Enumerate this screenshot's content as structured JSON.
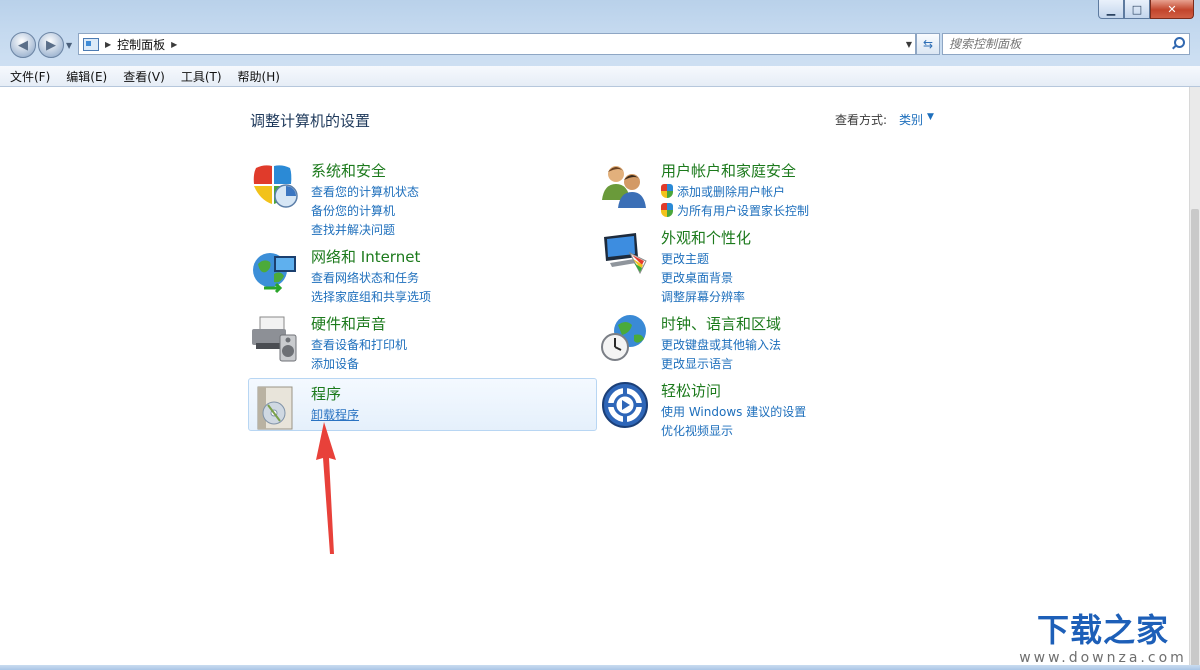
{
  "window": {
    "accent": "#b9d1ea"
  },
  "nav": {
    "back_icon": "back-arrow-icon",
    "forward_icon": "forward-arrow-icon",
    "breadcrumb": "控制面板",
    "search_placeholder": "搜索控制面板"
  },
  "menu": [
    "文件(F)",
    "编辑(E)",
    "查看(V)",
    "工具(T)",
    "帮助(H)"
  ],
  "header": {
    "title": "调整计算机的设置",
    "view_label": "查看方式:",
    "view_value": "类别"
  },
  "categories": {
    "system": {
      "title": "系统和安全",
      "icon": "shield-security-icon",
      "links": [
        "查看您的计算机状态",
        "备份您的计算机",
        "查找并解决问题"
      ]
    },
    "network": {
      "title": "网络和 Internet",
      "icon": "network-globe-icon",
      "links": [
        "查看网络状态和任务",
        "选择家庭组和共享选项"
      ]
    },
    "hardware": {
      "title": "硬件和声音",
      "icon": "printer-speaker-icon",
      "links": [
        "查看设备和打印机",
        "添加设备"
      ]
    },
    "programs": {
      "title": "程序",
      "icon": "programs-cd-icon",
      "links": [
        "卸载程序"
      ]
    },
    "users": {
      "title": "用户帐户和家庭安全",
      "icon": "users-icon",
      "links": [
        "添加或删除用户帐户",
        "为所有用户设置家长控制"
      ]
    },
    "appearance": {
      "title": "外观和个性化",
      "icon": "monitor-palette-icon",
      "links": [
        "更改主题",
        "更改桌面背景",
        "调整屏幕分辨率"
      ]
    },
    "clock": {
      "title": "时钟、语言和区域",
      "icon": "clock-globe-icon",
      "links": [
        "更改键盘或其他输入法",
        "更改显示语言"
      ]
    },
    "ease": {
      "title": "轻松访问",
      "icon": "ease-of-access-icon",
      "links": [
        "使用 Windows 建议的设置",
        "优化视频显示"
      ]
    }
  },
  "watermark": {
    "text": "下载之家",
    "url": "www.downza.com"
  },
  "colors": {
    "category_title": "#1c7a1c",
    "link": "#1e6fbc",
    "annotation_arrow": "#e8413a"
  }
}
